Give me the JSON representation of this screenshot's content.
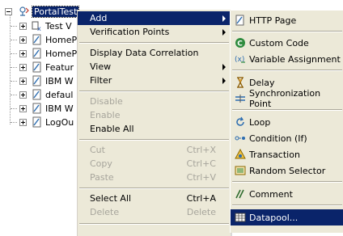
{
  "tree": {
    "root": "PortalTest",
    "children": [
      "Test V",
      "HomeP",
      "HomeP",
      "Featur",
      "IBM W",
      "defaul",
      "IBM W",
      "LogOu"
    ]
  },
  "menu": {
    "add": "Add",
    "verification_points": "Verification Points",
    "display_data_correlation": "Display Data Correlation",
    "view": "View",
    "filter": "Filter",
    "disable": "Disable",
    "enable": "Enable",
    "enable_all": "Enable All",
    "cut": "Cut",
    "cut_shortcut": "Ctrl+X",
    "copy": "Copy",
    "copy_shortcut": "Ctrl+C",
    "paste": "Paste",
    "paste_shortcut": "Ctrl+V",
    "select_all": "Select All",
    "select_all_shortcut": "Ctrl+A",
    "delete": "Delete",
    "delete_shortcut": "Delete"
  },
  "submenu": {
    "http_page": "HTTP Page",
    "custom_code": "Custom Code",
    "variable_assignment": "Variable Assignment",
    "delay": "Delay",
    "synchronization_point": "Synchronization Point",
    "loop": "Loop",
    "condition": "Condition (If)",
    "transaction": "Transaction",
    "random_selector": "Random Selector",
    "comment": "Comment",
    "datapool": "Datapool..."
  },
  "colors": {
    "selection": "#0a246a",
    "menu_bg": "#ece9d8",
    "disabled_text": "#a7a59c"
  }
}
